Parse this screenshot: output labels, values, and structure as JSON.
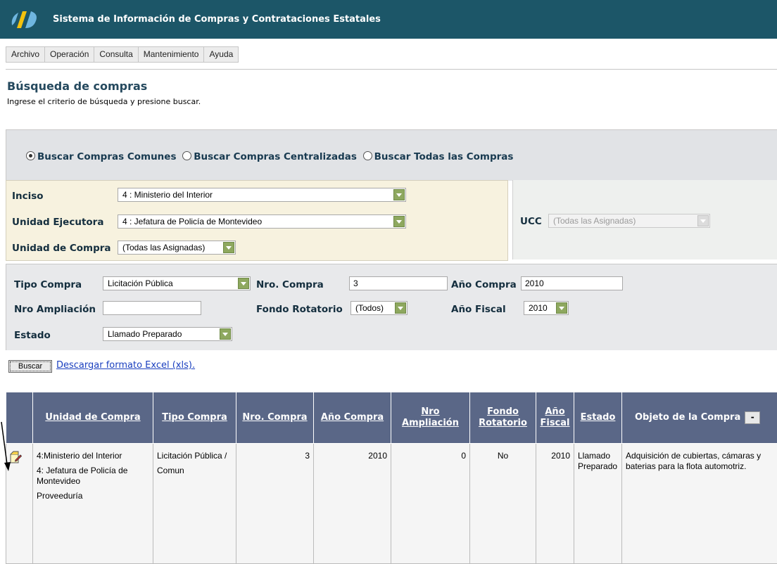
{
  "header": {
    "title": "Sistema de Información de Compras y Contrataciones Estatales",
    "brand_color": "#1c5668"
  },
  "menu": [
    "Archivo",
    "Operación",
    "Consulta",
    "Mantenimiento",
    "Ayuda"
  ],
  "page": {
    "title": "Búsqueda de compras",
    "subtitle": "Ingrese el criterio de búsqueda y presione buscar."
  },
  "search_mode": {
    "options": [
      "Buscar Compras Comunes",
      "Buscar Compras Centralizadas",
      "Buscar Todas las Compras"
    ],
    "selected": "Buscar Compras Comunes"
  },
  "organization": {
    "inciso": {
      "label": "Inciso",
      "value": "4 : Ministerio del Interior"
    },
    "unidad_ejecutora": {
      "label": "Unidad Ejecutora",
      "value": "4 : Jefatura de Policía de Montevideo"
    },
    "unidad_compra": {
      "label": "Unidad de Compra",
      "value": "(Todas las Asignadas)"
    },
    "ucc": {
      "label": "UCC",
      "value": "(Todas las Asignadas)"
    }
  },
  "criteria": {
    "tipo_compra": {
      "label": "Tipo Compra",
      "value": "Licitación Pública"
    },
    "nro_compra": {
      "label": "Nro. Compra",
      "value": "3"
    },
    "anio_compra": {
      "label": "Año Compra",
      "value": "2010"
    },
    "nro_ampliacion": {
      "label": "Nro Ampliación",
      "value": ""
    },
    "fondo_rotatorio": {
      "label": "Fondo Rotatorio",
      "value": "(Todos)"
    },
    "anio_fiscal": {
      "label": "Año Fiscal",
      "value": "2010"
    },
    "estado": {
      "label": "Estado",
      "value": "Llamado Preparado"
    }
  },
  "actions": {
    "buscar": "Buscar",
    "excel": "Descargar formato Excel (xls)."
  },
  "results": {
    "headers": {
      "unidad": "Unidad de Compra",
      "tipo": "Tipo Compra",
      "nro": "Nro. Compra",
      "anio": "Año Compra",
      "ampliacion": "Nro Ampliación",
      "fondo": "Fondo Rotatorio",
      "fiscal": "Año Fiscal",
      "estado": "Estado",
      "objeto": "Objeto de la Compra",
      "toggle": "-"
    },
    "rows": [
      {
        "unidad": [
          "4:Ministerio del Interior",
          "4: Jefatura de Policía de Montevideo",
          "Proveeduría"
        ],
        "tipo": [
          "Licitación Pública /",
          "Comun"
        ],
        "nro": "3",
        "anio": "2010",
        "ampliacion": "0",
        "fondo": "No",
        "fiscal": "2010",
        "estado": "Llamado Preparado",
        "objeto": "Adquisición de cubiertas, cámaras y baterias para la flota automotriz."
      }
    ]
  }
}
